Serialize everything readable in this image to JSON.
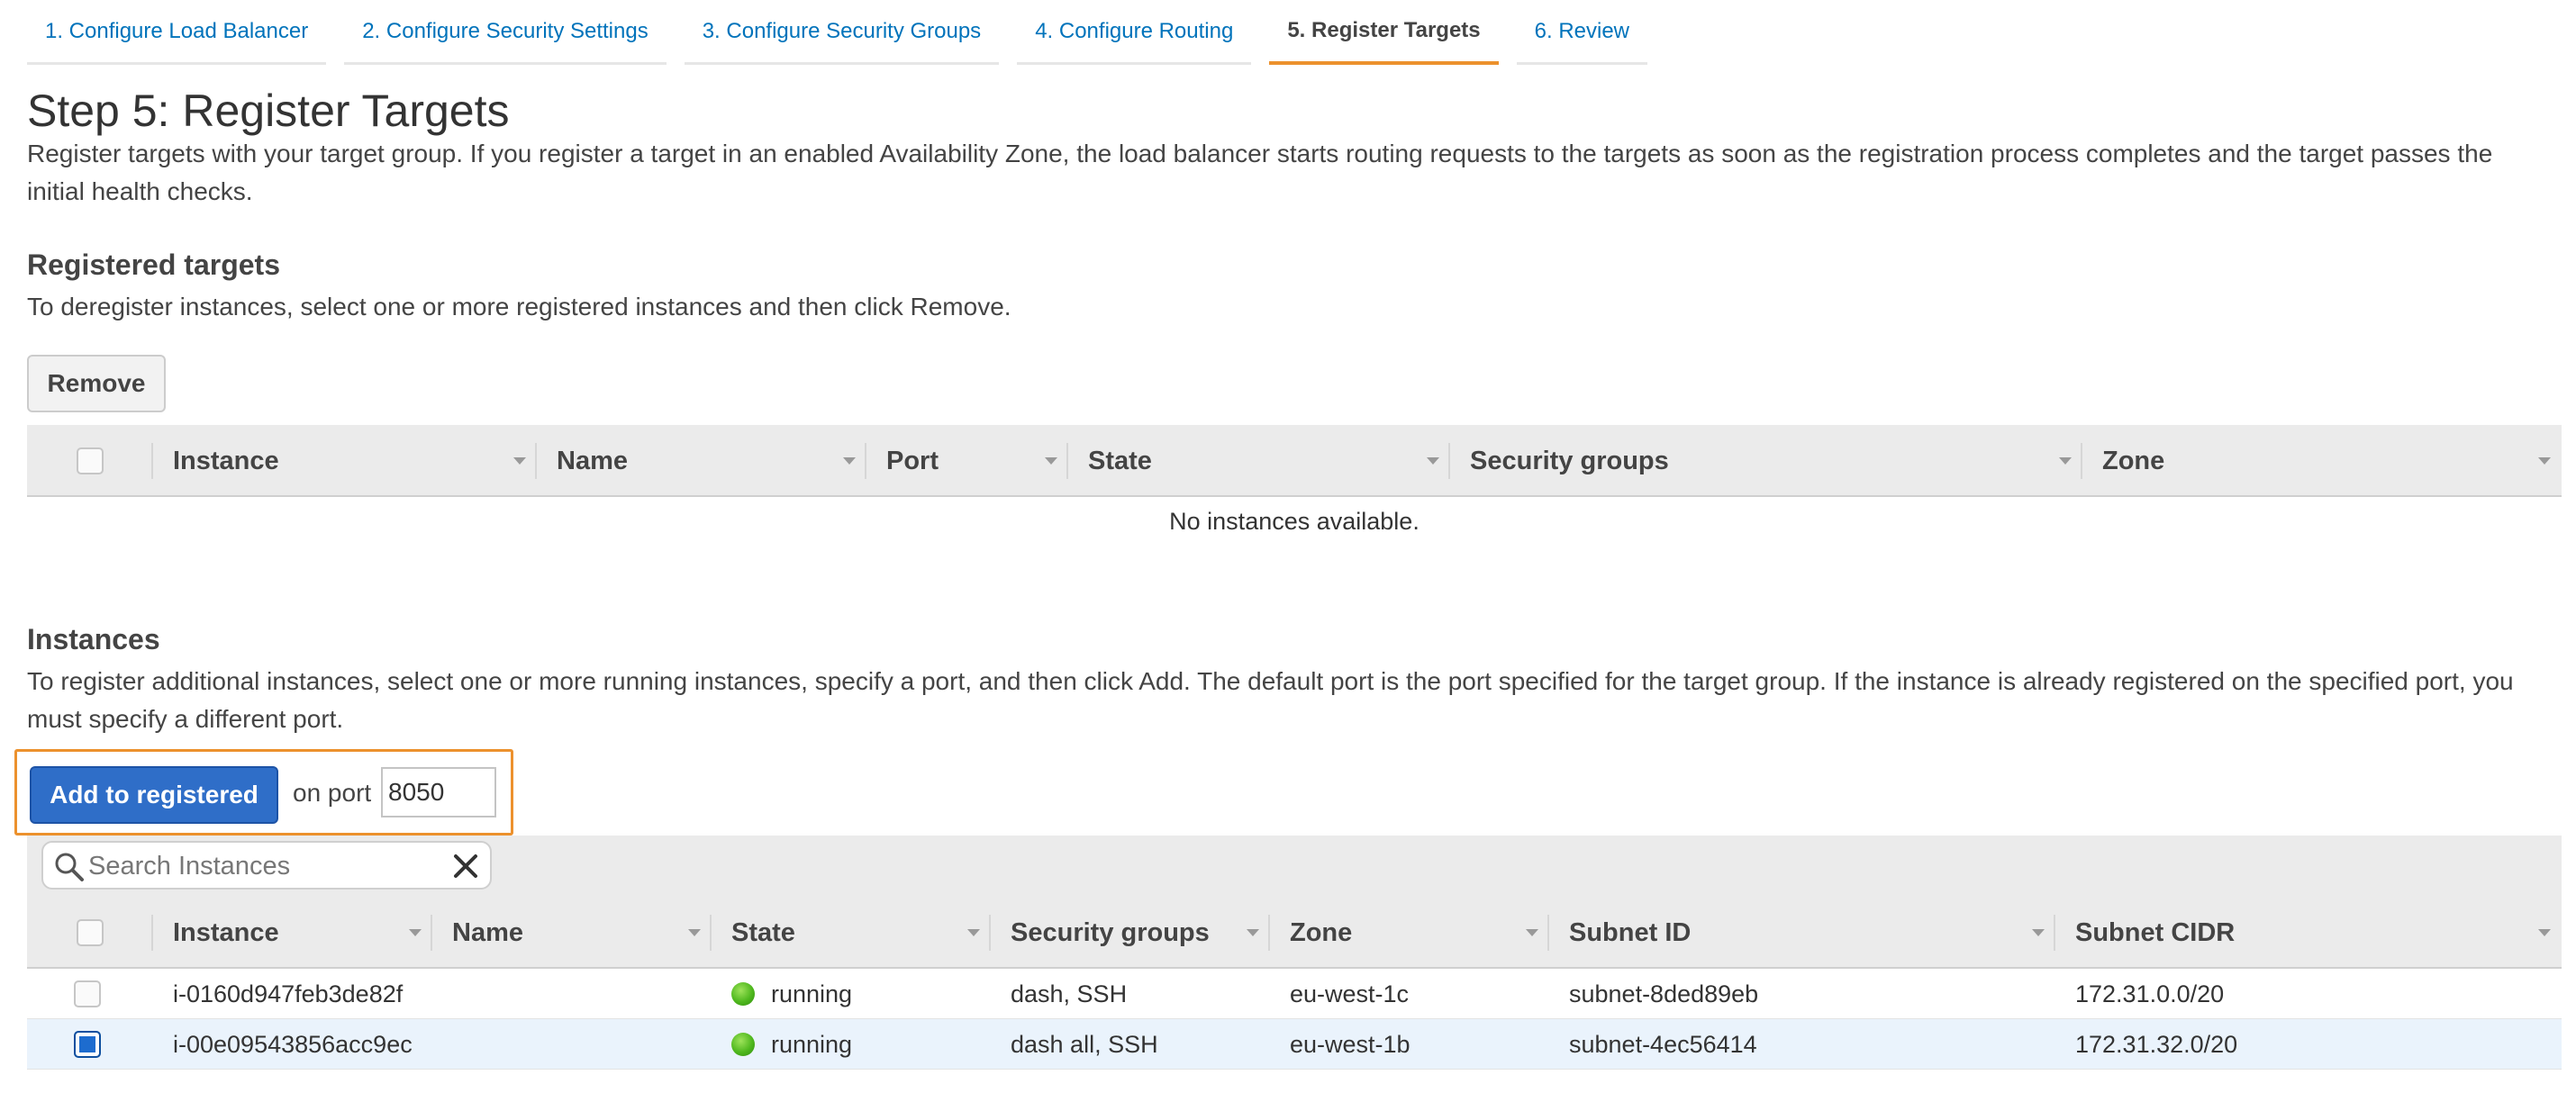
{
  "steps": [
    {
      "label": "1. Configure Load Balancer",
      "active": false
    },
    {
      "label": "2. Configure Security Settings",
      "active": false
    },
    {
      "label": "3. Configure Security Groups",
      "active": false
    },
    {
      "label": "4. Configure Routing",
      "active": false
    },
    {
      "label": "5. Register Targets",
      "active": true
    },
    {
      "label": "6. Review",
      "active": false
    }
  ],
  "page": {
    "title": "Step 5: Register Targets",
    "description": "Register targets with your target group. If you register a target in an enabled Availability Zone, the load balancer starts routing requests to the targets as soon as the registration process completes and the target passes the initial health checks."
  },
  "registered": {
    "heading": "Registered targets",
    "description": "To deregister instances, select one or more registered instances and then click Remove.",
    "remove_label": "Remove",
    "columns": [
      "Instance",
      "Name",
      "Port",
      "State",
      "Security groups",
      "Zone"
    ],
    "empty_message": "No instances available."
  },
  "instances": {
    "heading": "Instances",
    "description": "To register additional instances, select one or more running instances, specify a port, and then click Add. The default port is the port specified for the target group. If the instance is already registered on the specified port, you must specify a different port.",
    "add_label": "Add to registered",
    "on_port_label": "on port",
    "port_value": "8050",
    "search_placeholder": "Search Instances",
    "columns": [
      "Instance",
      "Name",
      "State",
      "Security groups",
      "Zone",
      "Subnet ID",
      "Subnet CIDR"
    ],
    "rows": [
      {
        "instance": "i-0160d947feb3de82f",
        "name": "",
        "state": "running",
        "security_groups": "dash, SSH",
        "zone": "eu-west-1c",
        "subnet_id": "subnet-8ded89eb",
        "subnet_cidr": "172.31.0.0/20",
        "selected": false
      },
      {
        "instance": "i-00e09543856acc9ec",
        "name": "",
        "state": "running",
        "security_groups": "dash all, SSH",
        "zone": "eu-west-1b",
        "subnet_id": "subnet-4ec56414",
        "subnet_cidr": "172.31.32.0/20",
        "selected": true
      }
    ]
  },
  "colors": {
    "accent_orange": "#ec912d",
    "link_blue": "#0073bb",
    "primary_button": "#2f6ec8",
    "running_green": "#4fb81e",
    "selected_row": "#eaf3fc"
  }
}
